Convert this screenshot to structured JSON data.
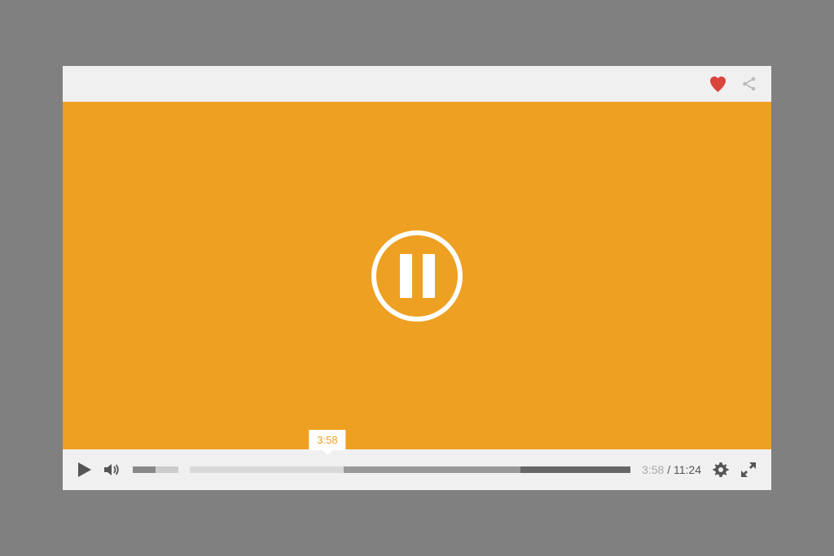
{
  "player": {
    "state": "paused",
    "tooltip_time": "3:58",
    "current_time": "3:58",
    "total_time": "11:24",
    "time_separator": " / ",
    "progress_played_pct": 35,
    "progress_buffered_pct": 40,
    "volume_pct": 50,
    "colors": {
      "video_bg": "#eea023",
      "heart": "#D9453D"
    }
  }
}
